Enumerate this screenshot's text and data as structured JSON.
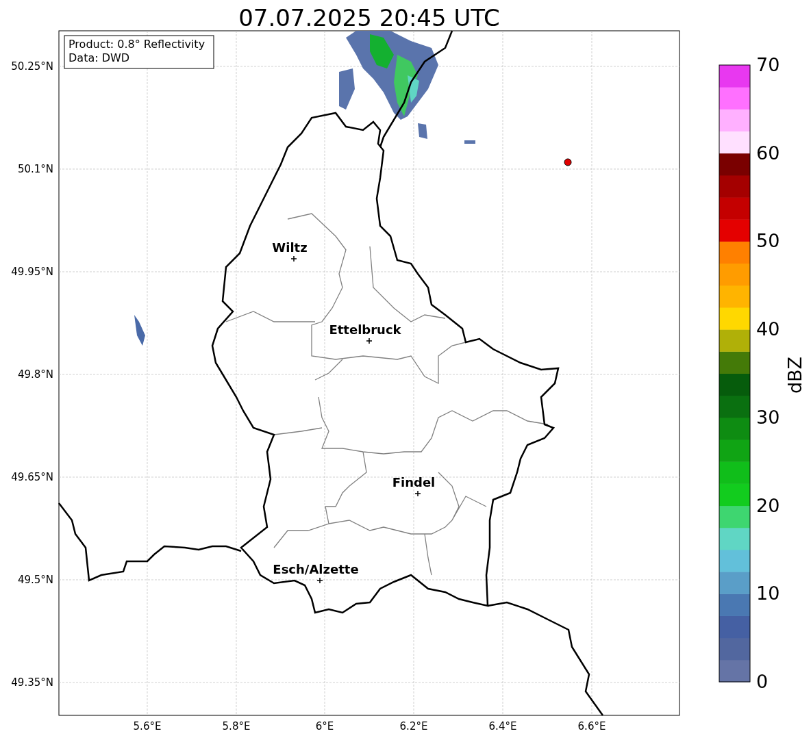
{
  "title": "07.07.2025 20:45 UTC",
  "info_box": [
    "Product: 0.8° Reflectivity",
    "Data: DWD"
  ],
  "y_ticks": [
    "50.25°N",
    "50.1°N",
    "49.95°N",
    "49.8°N",
    "49.65°N",
    "49.5°N",
    "49.35°N"
  ],
  "x_ticks": [
    "5.6°E",
    "5.8°E",
    "6°E",
    "6.2°E",
    "6.4°E",
    "6.6°E"
  ],
  "cities": [
    {
      "name": "Wiltz"
    },
    {
      "name": "Ettelbruck"
    },
    {
      "name": "Findel"
    },
    {
      "name": "Esch/Alzette"
    }
  ],
  "colorbar": {
    "label": "dBZ",
    "ticks": [
      "70",
      "60",
      "50",
      "40",
      "30",
      "20",
      "10",
      "0"
    ],
    "segments": [
      {
        "color": "#6574a6"
      },
      {
        "color": "#52679f"
      },
      {
        "color": "#4560a3"
      },
      {
        "color": "#4a78b2"
      },
      {
        "color": "#5a9ec8"
      },
      {
        "color": "#62c0da"
      },
      {
        "color": "#60d6c4"
      },
      {
        "color": "#3ed670"
      },
      {
        "color": "#12cc1e"
      },
      {
        "color": "#10be1a"
      },
      {
        "color": "#10a414"
      },
      {
        "color": "#0e8c12"
      },
      {
        "color": "#0a7010"
      },
      {
        "color": "#065c0c"
      },
      {
        "color": "#447a08"
      },
      {
        "color": "#b0b008"
      },
      {
        "color": "#ffd800"
      },
      {
        "color": "#ffb400"
      },
      {
        "color": "#ff9c00"
      },
      {
        "color": "#ff8000"
      },
      {
        "color": "#e40000"
      },
      {
        "color": "#c40000"
      },
      {
        "color": "#a40000"
      },
      {
        "color": "#7a0000"
      },
      {
        "color": "#ffe0ff"
      },
      {
        "color": "#ffb0ff"
      },
      {
        "color": "#ff70ff"
      },
      {
        "color": "#e838f0"
      }
    ]
  }
}
